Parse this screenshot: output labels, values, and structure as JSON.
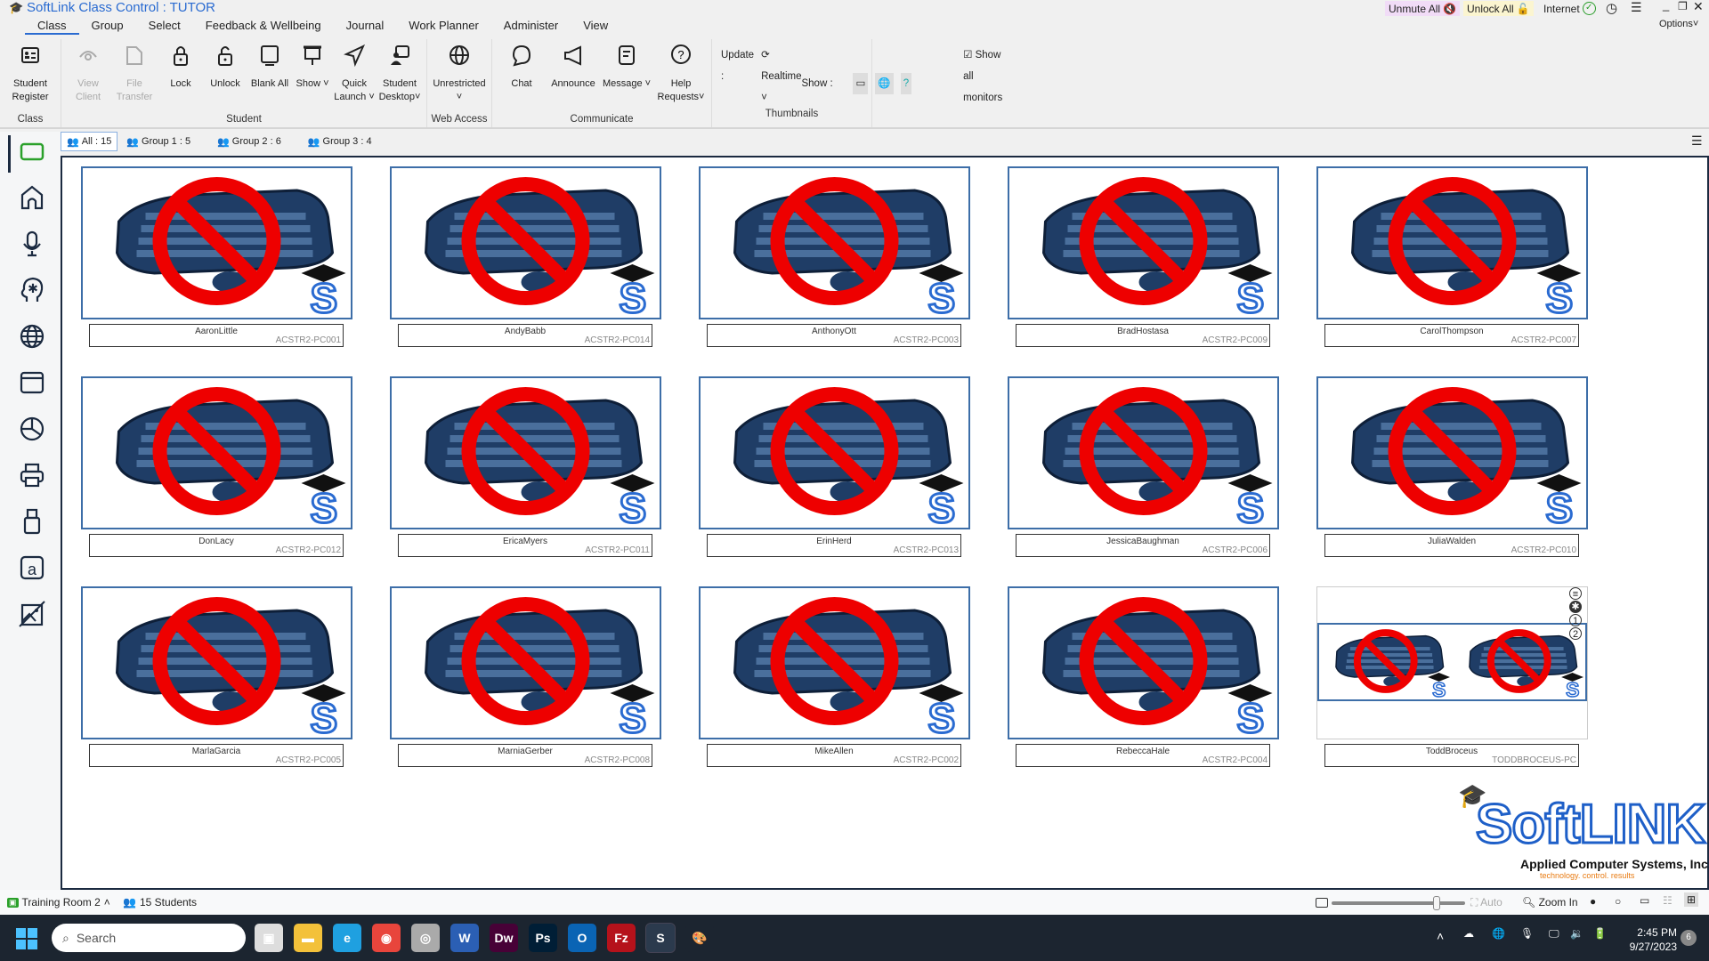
{
  "window": {
    "title": "SoftLink Class Control : TUTOR",
    "unmute_all": "Unmute All",
    "unlock_all": "Unlock All",
    "internet": "Internet",
    "options": "Options"
  },
  "menu": [
    "Class",
    "Group",
    "Select",
    "Feedback & Wellbeing",
    "Journal",
    "Work Planner",
    "Administer",
    "View"
  ],
  "ribbon": {
    "groups": [
      {
        "label": "Class",
        "buttons": [
          {
            "icon": "student-register-icon",
            "label": "Student Register"
          }
        ]
      },
      {
        "label": "Student",
        "buttons": [
          {
            "icon": "view-client-icon",
            "label": "View Client",
            "disabled": true
          },
          {
            "icon": "file-transfer-icon",
            "label": "File Transfer",
            "disabled": true
          },
          {
            "icon": "lock-icon",
            "label": "Lock"
          },
          {
            "icon": "unlock-icon",
            "label": "Unlock"
          },
          {
            "icon": "blank-screen-icon",
            "label": "Blank All"
          },
          {
            "icon": "show-icon",
            "label": "Show ˅"
          },
          {
            "icon": "quick-launch-icon",
            "label": "Quick Launch ˅"
          },
          {
            "icon": "student-desktop-icon",
            "label": "Student Desktop˅"
          }
        ]
      },
      {
        "label": "Web Access",
        "buttons": [
          {
            "icon": "globe-icon",
            "label": "Unrestricted ˅"
          }
        ]
      },
      {
        "label": "Communicate",
        "buttons": [
          {
            "icon": "chat-icon",
            "label": "Chat"
          },
          {
            "icon": "announce-icon",
            "label": "Announce"
          },
          {
            "icon": "message-icon",
            "label": "Message ˅"
          },
          {
            "icon": "help-icon",
            "label": "Help Requests˅"
          }
        ]
      }
    ],
    "thumbnails": {
      "label": "Thumbnails",
      "update_label": "Update :",
      "update_value": "Realtime",
      "show_label": "Show :",
      "show_all_monitors": "Show all monitors",
      "show_all_monitors_checked": true
    }
  },
  "group_tabs": [
    "All : 15",
    "Group 1 : 5",
    "Group 2 : 6",
    "Group 3 : 4"
  ],
  "sidebar": [
    "class-view-icon",
    "home-icon",
    "microphone-icon",
    "wellbeing-head-icon",
    "globe-icon",
    "window-icon",
    "pie-chart-icon",
    "printer-icon",
    "usb-icon",
    "text-icon",
    "image-icon"
  ],
  "students": [
    {
      "name": "AaronLittle",
      "pc": "ACSTR2-PC001"
    },
    {
      "name": "AndyBabb",
      "pc": "ACSTR2-PC014"
    },
    {
      "name": "AnthonyOtt",
      "pc": "ACSTR2-PC003"
    },
    {
      "name": "BradHostasa",
      "pc": "ACSTR2-PC009"
    },
    {
      "name": "CarolThompson",
      "pc": "ACSTR2-PC007"
    },
    {
      "name": "DonLacy",
      "pc": "ACSTR2-PC012"
    },
    {
      "name": "EricaMyers",
      "pc": "ACSTR2-PC011"
    },
    {
      "name": "ErinHerd",
      "pc": "ACSTR2-PC013"
    },
    {
      "name": "JessicaBaughman",
      "pc": "ACSTR2-PC006"
    },
    {
      "name": "JuliaWalden",
      "pc": "ACSTR2-PC010"
    },
    {
      "name": "MarlaGarcia",
      "pc": "ACSTR2-PC005"
    },
    {
      "name": "MarniaGerber",
      "pc": "ACSTR2-PC008"
    },
    {
      "name": "MikeAllen",
      "pc": "ACSTR2-PC002"
    },
    {
      "name": "RebeccaHale",
      "pc": "ACSTR2-PC004"
    },
    {
      "name": "ToddBroceus",
      "pc": "TODDBROCEUS-PC",
      "dual_monitor": true
    }
  ],
  "logo": {
    "brand": "SoftLINK",
    "company": "Applied Computer Systems, Inc.",
    "tagline": "technology. control. results"
  },
  "status": {
    "room": "Training Room 2",
    "students": "15 Students",
    "auto": "Auto",
    "zoom_in": "Zoom In"
  },
  "taskbar": {
    "search_placeholder": "Search",
    "time": "2:45 PM",
    "date": "9/27/2023",
    "notifications": "6",
    "apps": [
      {
        "icon": "task-view-icon",
        "glyph": "▣",
        "color": "#ddd"
      },
      {
        "icon": "file-explorer-icon",
        "glyph": "▬",
        "color": "#f3c13a"
      },
      {
        "icon": "edge-icon",
        "glyph": "e",
        "color": "#1fa0e0"
      },
      {
        "icon": "chrome-icon",
        "glyph": "◉",
        "color": "#e8453c"
      },
      {
        "icon": "speaker-app-icon",
        "glyph": "◎",
        "color": "#aaa"
      },
      {
        "icon": "word-icon",
        "glyph": "W",
        "color": "#2b5fb4"
      },
      {
        "icon": "dreamweaver-icon",
        "glyph": "Dw",
        "color": "#470137"
      },
      {
        "icon": "photoshop-icon",
        "glyph": "Ps",
        "color": "#001e36"
      },
      {
        "icon": "outlook-icon",
        "glyph": "O",
        "color": "#0a64b4"
      },
      {
        "icon": "filezilla-icon",
        "glyph": "Fz",
        "color": "#b5121b"
      },
      {
        "icon": "softlink-icon",
        "glyph": "S",
        "color": "#2b3a4d"
      },
      {
        "icon": "paint-icon",
        "glyph": "🎨",
        "color": "#1c2530"
      }
    ]
  },
  "colors": {
    "accent": "#2a6bd1",
    "thumb_border": "#3d6ea8",
    "sidebar_selected": "#2aa02a",
    "taskbar": "#1c2530"
  }
}
